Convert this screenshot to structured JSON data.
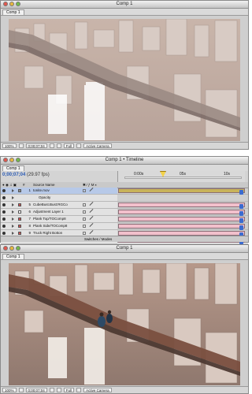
{
  "comp_top": {
    "title": "Comp 1",
    "tab": "Comp 1",
    "footer": {
      "zoom": "100%",
      "timecode": "0;00;07;04",
      "resolution": "Full",
      "view": "Active Camera"
    }
  },
  "timeline": {
    "title": "Comp 1 • Timeline",
    "tab": "Comp 1",
    "timecode": "0;00;07;04",
    "fps": "(29.97 fps)",
    "ruler": [
      "0:00s",
      "05s",
      "10s"
    ],
    "col_source": "Source Name",
    "layers": [
      {
        "num": "1",
        "name": "tonite.mov",
        "color": "#8a8a8a",
        "bar": "#c8b35a",
        "selected": true
      },
      {
        "num": "",
        "name": "Opacity",
        "color": "",
        "bar": "",
        "selected": false
      },
      {
        "num": "5",
        "name": "CubeBust.Bust:RGCo",
        "color": "#d05050",
        "bar": "#f2c0cc",
        "selected": false
      },
      {
        "num": "6",
        "name": "Adjustment Layer 1",
        "color": "#ffffff",
        "bar": "#f2c0cc",
        "selected": false
      },
      {
        "num": "7",
        "name": "Plank Top/TOComp8",
        "color": "#d05050",
        "bar": "#f2c0cc",
        "selected": false
      },
      {
        "num": "8",
        "name": "Plank Side/TOComp8",
        "color": "#d05050",
        "bar": "#f2c0cc",
        "selected": false
      },
      {
        "num": "9",
        "name": "Truck Right Botton",
        "color": "#d05050",
        "bar": "#f2c0cc",
        "selected": false
      },
      {
        "num": "10",
        "name": "Truck Middle Botton",
        "color": "#d05050",
        "bar": "#f2c0cc",
        "selected": false
      },
      {
        "num": "11",
        "name": "Cab Left Middle Top",
        "color": "#d05050",
        "bar": "#f2c0cc",
        "selected": false
      },
      {
        "num": "12",
        "name": "Cab Left Middle/RGC",
        "color": "#d05050",
        "bar": "#f2c0cc",
        "selected": false
      }
    ],
    "bottom_button": "Switches / Modes"
  },
  "comp_bottom": {
    "title": "Comp 1",
    "tab": "Comp 1",
    "footer": {
      "zoom": "100%",
      "timecode": "0;00;07;04",
      "resolution": "Full",
      "view": "Active Camera"
    }
  }
}
